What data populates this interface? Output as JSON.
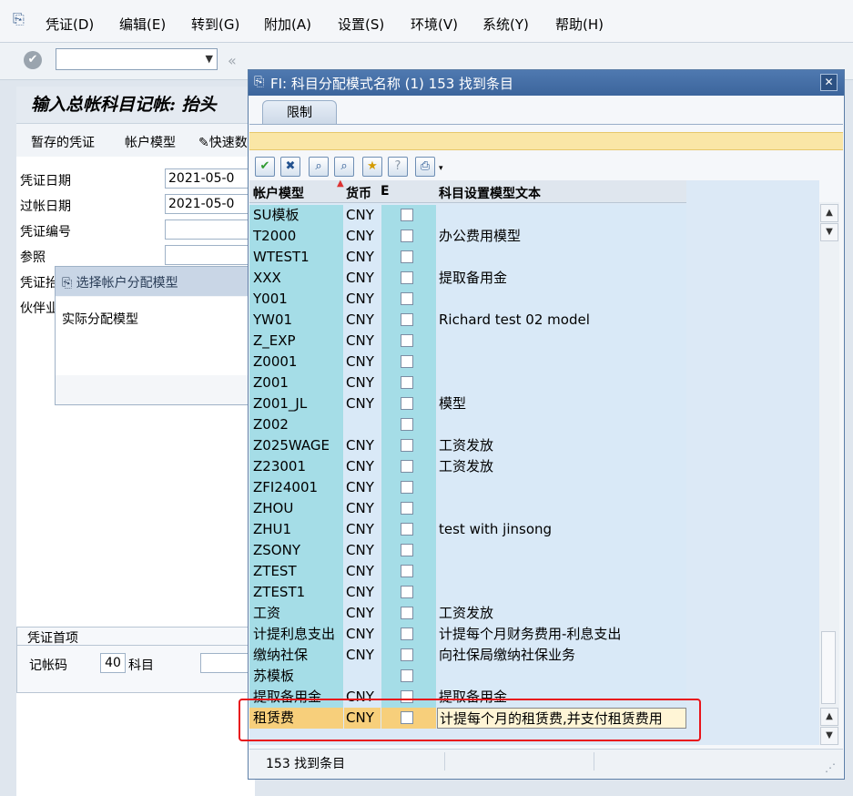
{
  "menubar": {
    "items": [
      "凭证(D)",
      "编辑(E)",
      "转到(G)",
      "附加(A)",
      "设置(S)",
      "环境(V)",
      "系统(Y)",
      "帮助(H)"
    ]
  },
  "background": {
    "title": "输入总帐科目记帐: 抬头",
    "app_toolbar": [
      "暂存的凭证",
      "帐户模型",
      "快速数据输入"
    ],
    "fields": [
      {
        "label": "凭证日期",
        "value": "2021-05-0"
      },
      {
        "label": "过帐日期",
        "value": "2021-05-0"
      },
      {
        "label": "凭证编号",
        "value": ""
      },
      {
        "label": "参照",
        "value": ""
      },
      {
        "label": "凭证抬头文本",
        "value": ""
      },
      {
        "label": "伙伴业务范围",
        "value": ""
      }
    ],
    "frame": {
      "title": "凭证首项",
      "posting_key_label": "记帐码",
      "posting_key_value": "40",
      "account_label": "科目"
    }
  },
  "popup_small": {
    "title": "选择帐户分配模型",
    "field_label": "实际分配模型"
  },
  "dialog": {
    "title": "FI: 科目分配模式名称 (1)  153 找到条目",
    "tab": "限制",
    "columns": [
      "帐户模型",
      "货币",
      "E",
      "科目设置模型文本"
    ],
    "rows": [
      {
        "key": "SU模板",
        "cur": "CNY",
        "text": ""
      },
      {
        "key": "T2000",
        "cur": "CNY",
        "text": "办公费用模型"
      },
      {
        "key": "WTEST1",
        "cur": "CNY",
        "text": ""
      },
      {
        "key": "XXX",
        "cur": "CNY",
        "text": "提取备用金"
      },
      {
        "key": "Y001",
        "cur": "CNY",
        "text": ""
      },
      {
        "key": "YW01",
        "cur": "CNY",
        "text": "Richard test 02 model"
      },
      {
        "key": "Z_EXP",
        "cur": "CNY",
        "text": ""
      },
      {
        "key": "Z0001",
        "cur": "CNY",
        "text": ""
      },
      {
        "key": "Z001",
        "cur": "CNY",
        "text": ""
      },
      {
        "key": "Z001_JL",
        "cur": "CNY",
        "text": "模型"
      },
      {
        "key": "Z002",
        "cur": "",
        "text": ""
      },
      {
        "key": "Z025WAGE",
        "cur": "CNY",
        "text": "工资发放"
      },
      {
        "key": "Z23001",
        "cur": "CNY",
        "text": "工资发放"
      },
      {
        "key": "ZFI24001",
        "cur": "CNY",
        "text": ""
      },
      {
        "key": "ZHOU",
        "cur": "CNY",
        "text": ""
      },
      {
        "key": "ZHU1",
        "cur": "CNY",
        "text": "test with jinsong"
      },
      {
        "key": "ZSONY",
        "cur": "CNY",
        "text": ""
      },
      {
        "key": "ZTEST",
        "cur": "CNY",
        "text": ""
      },
      {
        "key": "ZTEST1",
        "cur": "CNY",
        "text": ""
      },
      {
        "key": "工资",
        "cur": "CNY",
        "text": "工资发放"
      },
      {
        "key": "计提利息支出",
        "cur": "CNY",
        "text": "计提每个月财务费用-利息支出"
      },
      {
        "key": "缴纳社保",
        "cur": "CNY",
        "text": "向社保局缴纳社保业务"
      },
      {
        "key": "苏模板",
        "cur": "",
        "text": ""
      },
      {
        "key": "提取备用金",
        "cur": "CNY",
        "text": "提取备用金"
      },
      {
        "key": "租赁费",
        "cur": "CNY",
        "text": "计提每个月的租赁费,并支付租赁费用",
        "selected": true
      }
    ],
    "status": "153 找到条目"
  }
}
